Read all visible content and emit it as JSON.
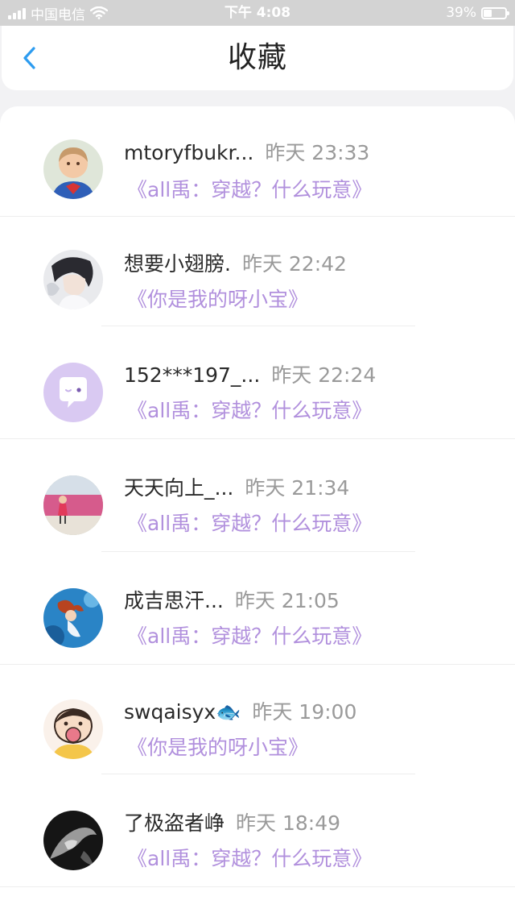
{
  "status_bar": {
    "carrier": "中国电信",
    "time": "下午 4:08",
    "battery": "39%",
    "battery_level": 0.39
  },
  "header": {
    "title": "收藏"
  },
  "items": [
    {
      "name": "mtoryfbukr...",
      "time": "昨天 23:33",
      "book": "《all禹：穿越？什么玩意》"
    },
    {
      "name": "想要小翅膀.",
      "time": "昨天 22:42",
      "book": "《你是我的呀小宝》"
    },
    {
      "name": "152***197_...",
      "time": "昨天 22:24",
      "book": "《all禹：穿越？什么玩意》"
    },
    {
      "name": "天天向上_...",
      "time": "昨天 21:34",
      "book": "《all禹：穿越？什么玩意》"
    },
    {
      "name": "成吉思汗...",
      "time": "昨天 21:05",
      "book": "《all禹：穿越？什么玩意》"
    },
    {
      "name": "swqaisyx🐟",
      "time": "昨天 19:00",
      "book": "《你是我的呀小宝》"
    },
    {
      "name": "了极盗者峥",
      "time": "昨天 18:49",
      "book": "《all禹：穿越？什么玩意》"
    }
  ],
  "colors": {
    "accent": "#2d9cf0",
    "book_title": "#b190dd",
    "time_text": "#9a9a9a"
  }
}
